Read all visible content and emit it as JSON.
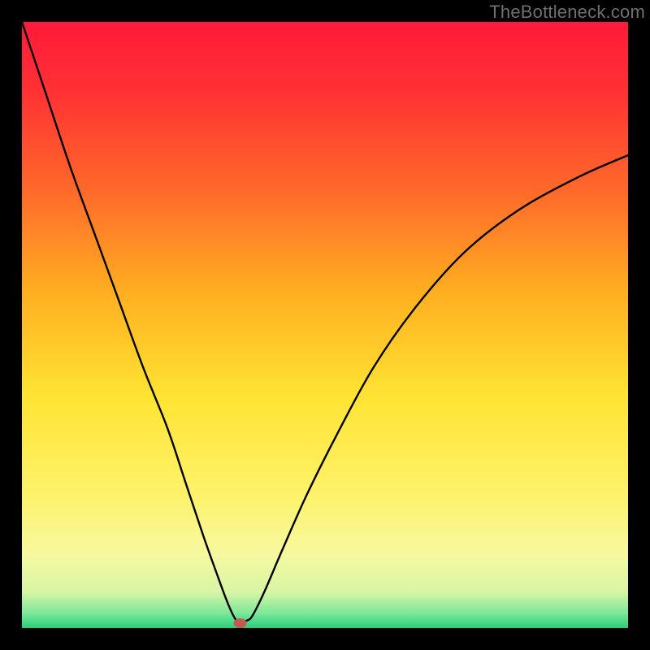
{
  "watermark": "TheBottleneck.com",
  "chart_data": {
    "type": "line",
    "title": "",
    "xlabel": "",
    "ylabel": "",
    "xlim": [
      0,
      100
    ],
    "ylim": [
      0,
      100
    ],
    "grid": false,
    "legend": false,
    "background_gradient": {
      "stops": [
        {
          "offset": 0.0,
          "color": "#ff1a3a"
        },
        {
          "offset": 0.12,
          "color": "#ff3333"
        },
        {
          "offset": 0.28,
          "color": "#ff6a2a"
        },
        {
          "offset": 0.45,
          "color": "#ffb020"
        },
        {
          "offset": 0.62,
          "color": "#ffe433"
        },
        {
          "offset": 0.78,
          "color": "#fdf26a"
        },
        {
          "offset": 0.88,
          "color": "#f6f9a0"
        },
        {
          "offset": 0.94,
          "color": "#d8f5a5"
        },
        {
          "offset": 0.975,
          "color": "#7fe89a"
        },
        {
          "offset": 1.0,
          "color": "#25d07a"
        }
      ]
    },
    "series": [
      {
        "name": "bottleneck-curve",
        "color": "#000000",
        "x": [
          0,
          4,
          8,
          12,
          16,
          20,
          24,
          27,
          30,
          32.5,
          34,
          35.2,
          36,
          37,
          38,
          40,
          43,
          47,
          52,
          58,
          65,
          73,
          82,
          92,
          100
        ],
        "y": [
          100,
          88,
          76,
          65,
          54,
          43,
          33,
          24,
          15,
          8,
          4,
          1.5,
          1,
          1.2,
          2,
          6,
          13,
          22,
          32,
          43,
          53,
          62,
          69,
          74.5,
          78
        ]
      }
    ],
    "marker": {
      "name": "optimal-point",
      "x": 36,
      "y": 0.8,
      "color": "#c35a4e",
      "rx": 8,
      "ry": 6
    }
  }
}
